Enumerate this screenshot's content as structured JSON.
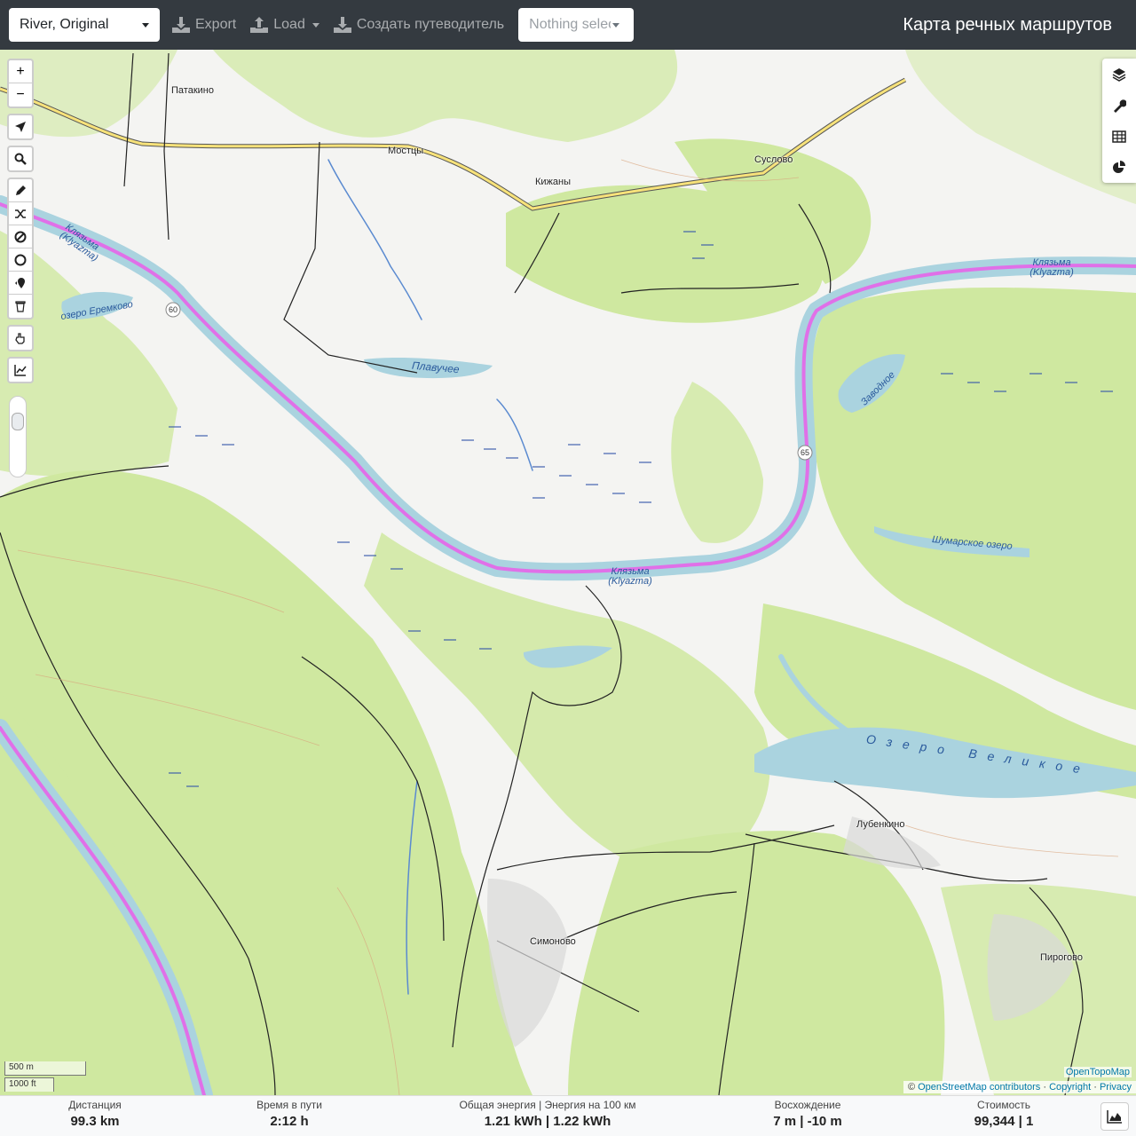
{
  "navbar": {
    "profile": "River, Original",
    "export_label": "Export",
    "load_label": "Load",
    "guide_label": "Создать путеводитель",
    "selection_label": "Nothing selected",
    "brand": "Карта речных маршрутов"
  },
  "map": {
    "places": [
      "Патакино",
      "Мостцы",
      "Кижаны",
      "Суслово",
      "Лубенкино",
      "Симоново",
      "Пирогово"
    ],
    "water_labels": [
      "Клязьма (Klyazma)",
      "Клязьма (Klyazma)",
      "Клязьма (Klyazma)",
      "озеро Еремково",
      "Плавучее",
      "Заводное",
      "Шумарское озеро",
      "Озеро Великое"
    ],
    "road_shields": [
      "60",
      "65"
    ],
    "zoom_in": "+",
    "zoom_out": "−",
    "scale_metric": "500 m",
    "scale_imperial": "1000 ft",
    "tile_credit": "OpenTopoMap",
    "attribution": {
      "prefix": "©",
      "osm": "OpenStreetMap contributors",
      "copyright": "Copyright",
      "privacy": "Privacy"
    }
  },
  "footer": {
    "distance": {
      "label": "Дистанция",
      "value": "99.3 km"
    },
    "time": {
      "label": "Время в пути",
      "value": "2:12 h"
    },
    "energy": {
      "label": "Общая энергия | Энергия на 100 км",
      "value": "1.21 kWh | 1.22 kWh"
    },
    "ascent": {
      "label": "Восхождение",
      "value": "7 m | -10 m"
    },
    "cost": {
      "label": "Стоимость",
      "value": "99,344 | 1"
    }
  },
  "colors": {
    "navbar": "#343a40",
    "forest": "#cfe8a0",
    "water": "#aad3df",
    "route": "#e070e8",
    "footer": "#f8f9fa"
  }
}
